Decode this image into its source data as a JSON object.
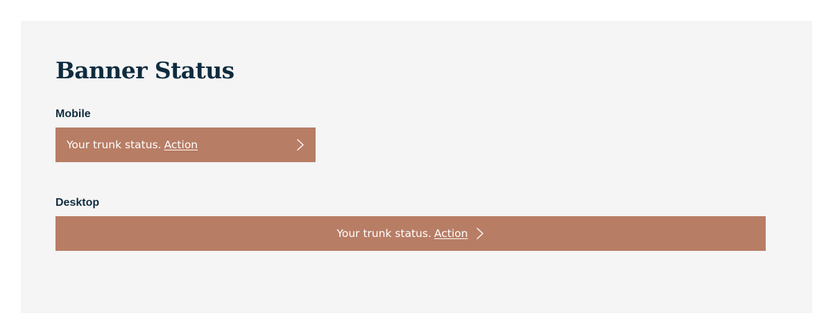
{
  "page": {
    "title": "Banner Status"
  },
  "sections": {
    "mobile": {
      "label": "Mobile",
      "banner": {
        "message": "Your trunk status.",
        "action_label": "Action",
        "icon": "chevron-right-icon"
      }
    },
    "desktop": {
      "label": "Desktop",
      "banner": {
        "message": "Your trunk status.",
        "action_label": "Action",
        "icon": "chevron-right-icon"
      }
    }
  },
  "colors": {
    "page_background": "#ffffff",
    "panel_background": "#f5f5f5",
    "heading_text": "#0f2c3f",
    "banner_background": "#b87d65",
    "banner_text": "#ffffff"
  }
}
